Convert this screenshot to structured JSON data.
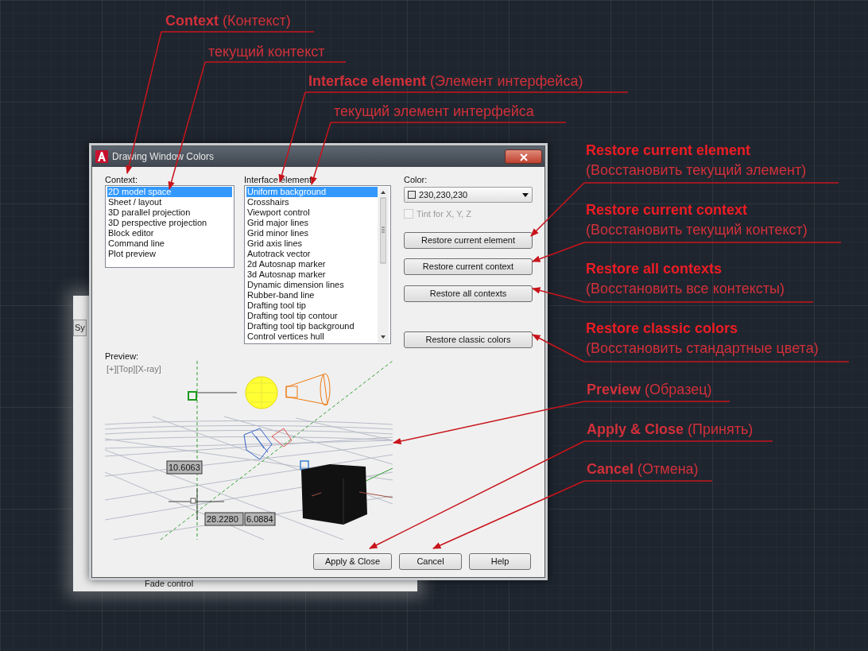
{
  "background_window": {
    "tab_label": "Sy",
    "field_label": "Fade control"
  },
  "dialog": {
    "title": "Drawing Window Colors",
    "context": {
      "label": "Context:",
      "items": [
        {
          "label": "2D model space",
          "selected": true
        },
        {
          "label": "Sheet / layout",
          "selected": false
        },
        {
          "label": "3D parallel projection",
          "selected": false
        },
        {
          "label": "3D perspective projection",
          "selected": false
        },
        {
          "label": "Block editor",
          "selected": false
        },
        {
          "label": "Command line",
          "selected": false
        },
        {
          "label": "Plot preview",
          "selected": false
        }
      ]
    },
    "interface_element": {
      "label": "Interface element",
      "items": [
        {
          "label": "Uniform background",
          "selected": true
        },
        {
          "label": "Crosshairs",
          "selected": false
        },
        {
          "label": "Viewport control",
          "selected": false
        },
        {
          "label": "Grid major lines",
          "selected": false
        },
        {
          "label": "Grid minor lines",
          "selected": false
        },
        {
          "label": "Grid axis lines",
          "selected": false
        },
        {
          "label": "Autotrack vector",
          "selected": false
        },
        {
          "label": "2d Autosnap marker",
          "selected": false
        },
        {
          "label": "3d Autosnap marker",
          "selected": false
        },
        {
          "label": "Dynamic dimension lines",
          "selected": false
        },
        {
          "label": "Rubber-band line",
          "selected": false
        },
        {
          "label": "Drafting tool tip",
          "selected": false
        },
        {
          "label": "Drafting tool tip contour",
          "selected": false
        },
        {
          "label": "Drafting tool tip background",
          "selected": false
        },
        {
          "label": "Control vertices hull",
          "selected": false
        }
      ]
    },
    "color": {
      "label": "Color:",
      "value": "230,230,230"
    },
    "tint": {
      "label": "Tint for X, Y, Z",
      "checked": false,
      "disabled": true
    },
    "restore_buttons": [
      "Restore current element",
      "Restore current context",
      "Restore all contexts",
      "Restore classic colors"
    ],
    "preview": {
      "label": "Preview:",
      "viewport_label": "[+][Top][X-ray]",
      "dimension_values": [
        "10.6063",
        "28.2280",
        "6.0884"
      ]
    },
    "buttons": [
      "Apply & Close",
      "Cancel",
      "Help"
    ]
  },
  "annotations": [
    {
      "kind": "inline",
      "text": "**Context** (Контекст)"
    },
    {
      "kind": "inline",
      "text": "текущий контекст"
    },
    {
      "kind": "inline",
      "text": "**Interface element** (Элемент интерфейса)"
    },
    {
      "kind": "inline",
      "text": "текущий элемент интерфейса"
    },
    {
      "kind": "stacked",
      "title": "Restore current element",
      "note": "(Восстановить текущий элемент)"
    },
    {
      "kind": "stacked",
      "title": "Restore current context",
      "note": "(Восстановить текущий контекст)"
    },
    {
      "kind": "stacked",
      "title": "Restore all contexts",
      "note": "(Восстановить все контексты)"
    },
    {
      "kind": "stacked",
      "title": "Restore classic colors",
      "note": "(Восстановить стандартные цвета)"
    },
    {
      "kind": "inline",
      "text": "**Preview** (Образец)"
    },
    {
      "kind": "inline",
      "text": "**Apply & Close** (Принять)"
    },
    {
      "kind": "inline",
      "text": "**Cancel** (Отмена)"
    }
  ]
}
